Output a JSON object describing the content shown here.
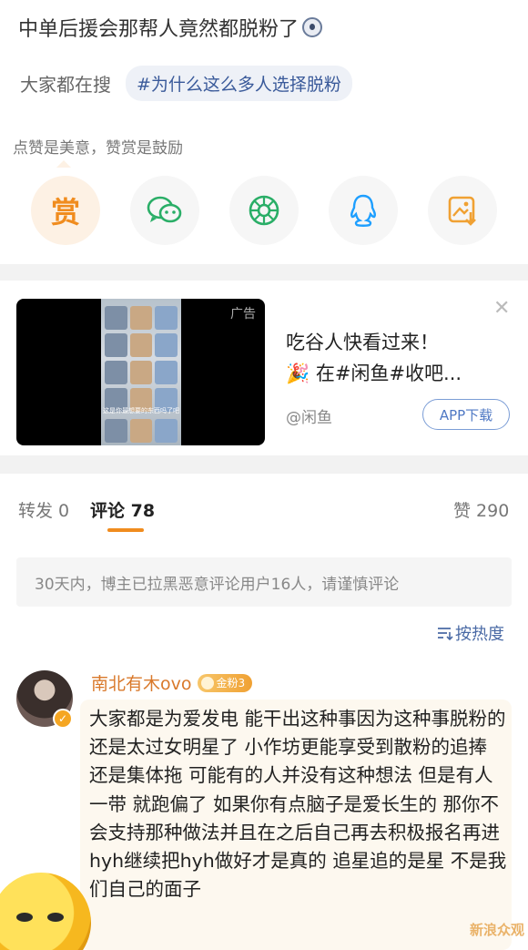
{
  "post": {
    "title": "中单后援会那帮人竟然都脱粉了",
    "emoji_icon": "shocked-face-icon"
  },
  "search": {
    "label": "大家都在搜",
    "tag": "#为什么这么多人选择脱粉"
  },
  "reward": {
    "hint": "点赞是美意，赞赏是鼓励",
    "button_label": "赏"
  },
  "share": {
    "icons": [
      "reward-icon",
      "wechat-icon",
      "moments-icon",
      "qq-icon",
      "save-image-icon"
    ]
  },
  "ad": {
    "badge": "广告",
    "line1": "吃谷人快看过来！",
    "line2": "在#闲鱼#收吧...",
    "source": "@闲鱼",
    "app_button": "APP下载",
    "caption": "这是你最想要的东西吗了吧"
  },
  "tabs": {
    "repost": "转发 0",
    "comments": "评论 78",
    "likes": "赞 290"
  },
  "notice": "30天内，博主已拉黑恶意评论用户16人，请谨慎评论",
  "sort_label": "按热度",
  "comment": {
    "author": "南北有木ovo",
    "fan_badge": "金粉3",
    "text": "大家都是为爱发电 能干出这种事因为这种事脱粉的 还是太过女明星了 小作坊更能享受到散粉的追捧 还是集体拖 可能有的人并没有这种想法 但是有人一带 就跑偏了 如果你有点脑子是爱长生的 那你不会支持那种做法并且在之后自己再去积极报名再进hyh继续把hyh做好才是真的 追星追的是星 不是我们自己的面子"
  },
  "watermark": "新浪众观",
  "colors": {
    "accent": "#f08c1e",
    "link": "#3a5a9a",
    "wechat": "#2aae67",
    "qq": "#1e9fff"
  }
}
